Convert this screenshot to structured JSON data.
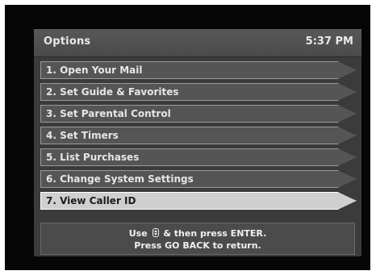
{
  "header": {
    "title": "Options",
    "time": "5:37 PM"
  },
  "menu": {
    "items": [
      {
        "label": "1.  Open Your Mail"
      },
      {
        "label": "2.  Set Guide & Favorites"
      },
      {
        "label": "3.  Set Parental Control"
      },
      {
        "label": "4.  Set Timers"
      },
      {
        "label": "5.  List Purchases"
      },
      {
        "label": "6.  Change System Settings"
      },
      {
        "label": "7.  View Caller ID"
      }
    ],
    "selected_index": 6
  },
  "help": {
    "line1_prefix": "Use",
    "line1_icon": "up-down-arrow-icon",
    "line1_suffix": "& then press ENTER.",
    "line2": "Press GO BACK to return."
  },
  "colors": {
    "panel": "#3b3b3b",
    "item": "#555555",
    "selected": "#cfcfcf",
    "text": "#e6e6e6"
  }
}
